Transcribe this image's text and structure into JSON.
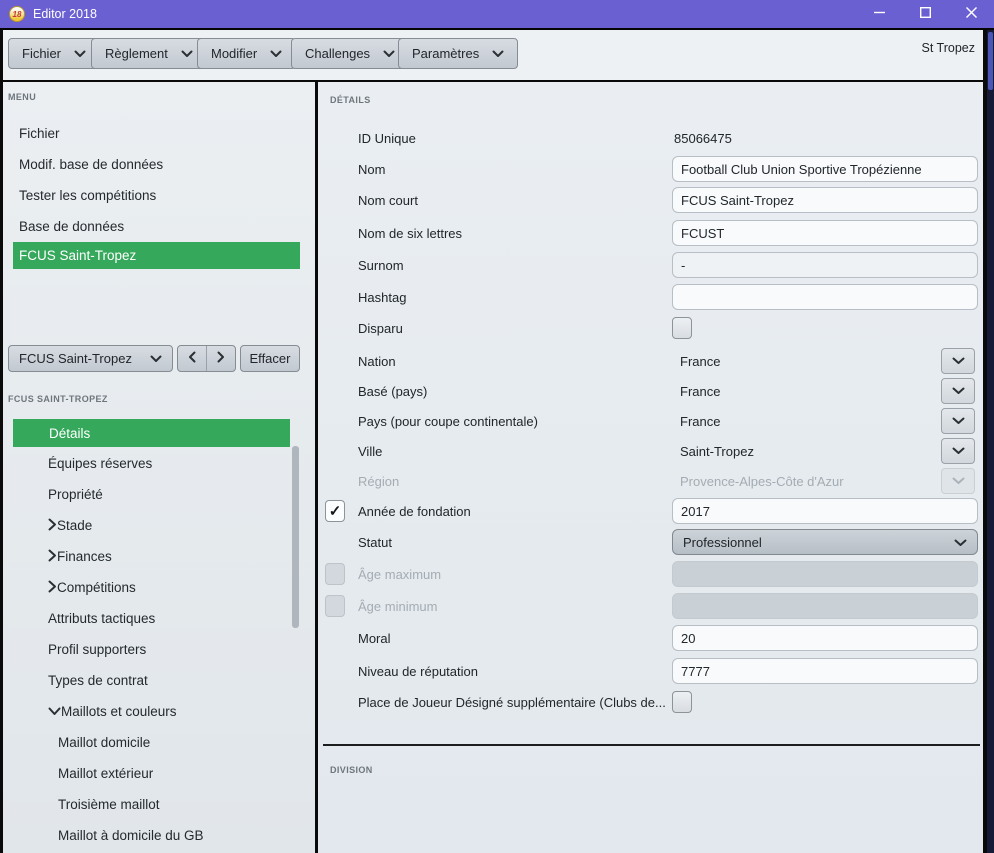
{
  "titlebar": {
    "title": "Editor 2018",
    "icon_label": "18"
  },
  "toolbar": {
    "menus": [
      {
        "label": "Fichier"
      },
      {
        "label": "Règlement"
      },
      {
        "label": "Modifier"
      },
      {
        "label": "Challenges"
      },
      {
        "label": "Paramètres"
      }
    ],
    "context_label": "St Tropez"
  },
  "sidebar": {
    "menu_header": "MENU",
    "menu_items": [
      {
        "label": "Fichier",
        "selected": false
      },
      {
        "label": "Modif. base de données",
        "selected": false
      },
      {
        "label": "Tester les compétitions",
        "selected": false
      },
      {
        "label": "Base de données",
        "selected": false
      },
      {
        "label": "FCUS Saint-Tropez",
        "selected": true
      }
    ],
    "navigator": {
      "value": "FCUS Saint-Tropez",
      "clear_label": "Effacer"
    },
    "section_header": "FCUS SAINT-TROPEZ",
    "nav_items": [
      {
        "label": "Détails",
        "selected": true
      },
      {
        "label": "Équipes réserves"
      },
      {
        "label": "Propriété"
      },
      {
        "label": "Stade",
        "expandable": true
      },
      {
        "label": "Finances",
        "expandable": true
      },
      {
        "label": "Compétitions",
        "expandable": true
      },
      {
        "label": "Attributs tactiques"
      },
      {
        "label": "Profil supporters"
      },
      {
        "label": "Types de contrat"
      },
      {
        "label": "Maillots et couleurs",
        "expanded": true
      },
      {
        "label": "Maillot domicile",
        "child": true
      },
      {
        "label": "Maillot extérieur",
        "child": true
      },
      {
        "label": "Troisième maillot",
        "child": true
      },
      {
        "label": "Maillot à domicile du GB",
        "child": true
      }
    ]
  },
  "main": {
    "section_header": "DÉTAILS",
    "fields": {
      "id_unique": {
        "label": "ID Unique",
        "value": "85066475"
      },
      "nom": {
        "label": "Nom",
        "value": "Football Club Union Sportive Tropézienne"
      },
      "nom_court": {
        "label": "Nom court",
        "value": "FCUS Saint-Tropez"
      },
      "nom_six_lettres": {
        "label": "Nom de six lettres",
        "value": "FCUST"
      },
      "surnom": {
        "label": "Surnom",
        "value": "-"
      },
      "hashtag": {
        "label": "Hashtag",
        "value": ""
      },
      "disparu": {
        "label": "Disparu",
        "checked": false
      },
      "nation": {
        "label": "Nation",
        "value": "France"
      },
      "base_pays": {
        "label": "Basé (pays)",
        "value": "France"
      },
      "pays_coupe": {
        "label": "Pays (pour coupe continentale)",
        "value": "France"
      },
      "ville": {
        "label": "Ville",
        "value": "Saint-Tropez"
      },
      "region": {
        "label": "Région",
        "value": "Provence-Alpes-Côte d'Azur",
        "disabled": true
      },
      "annee_fondation": {
        "label": "Année de fondation",
        "value": "2017",
        "checked": true
      },
      "statut": {
        "label": "Statut",
        "value": "Professionnel"
      },
      "age_maximum": {
        "label": "Âge maximum",
        "value": "",
        "checked": false,
        "disabled": true
      },
      "age_minimum": {
        "label": "Âge minimum",
        "value": "",
        "checked": false,
        "disabled": true
      },
      "moral": {
        "label": "Moral",
        "value": "20"
      },
      "reputation": {
        "label": "Niveau de réputation",
        "value": "7777"
      },
      "place_joueur": {
        "label": "Place de Joueur Désigné supplémentaire (Clubs de...",
        "checked": false
      }
    },
    "division_header": "DIVISION"
  },
  "colors": {
    "accent_green": "#35A85C",
    "titlebar_purple": "#6B60D2",
    "selection_text": "#FFFFFF"
  }
}
